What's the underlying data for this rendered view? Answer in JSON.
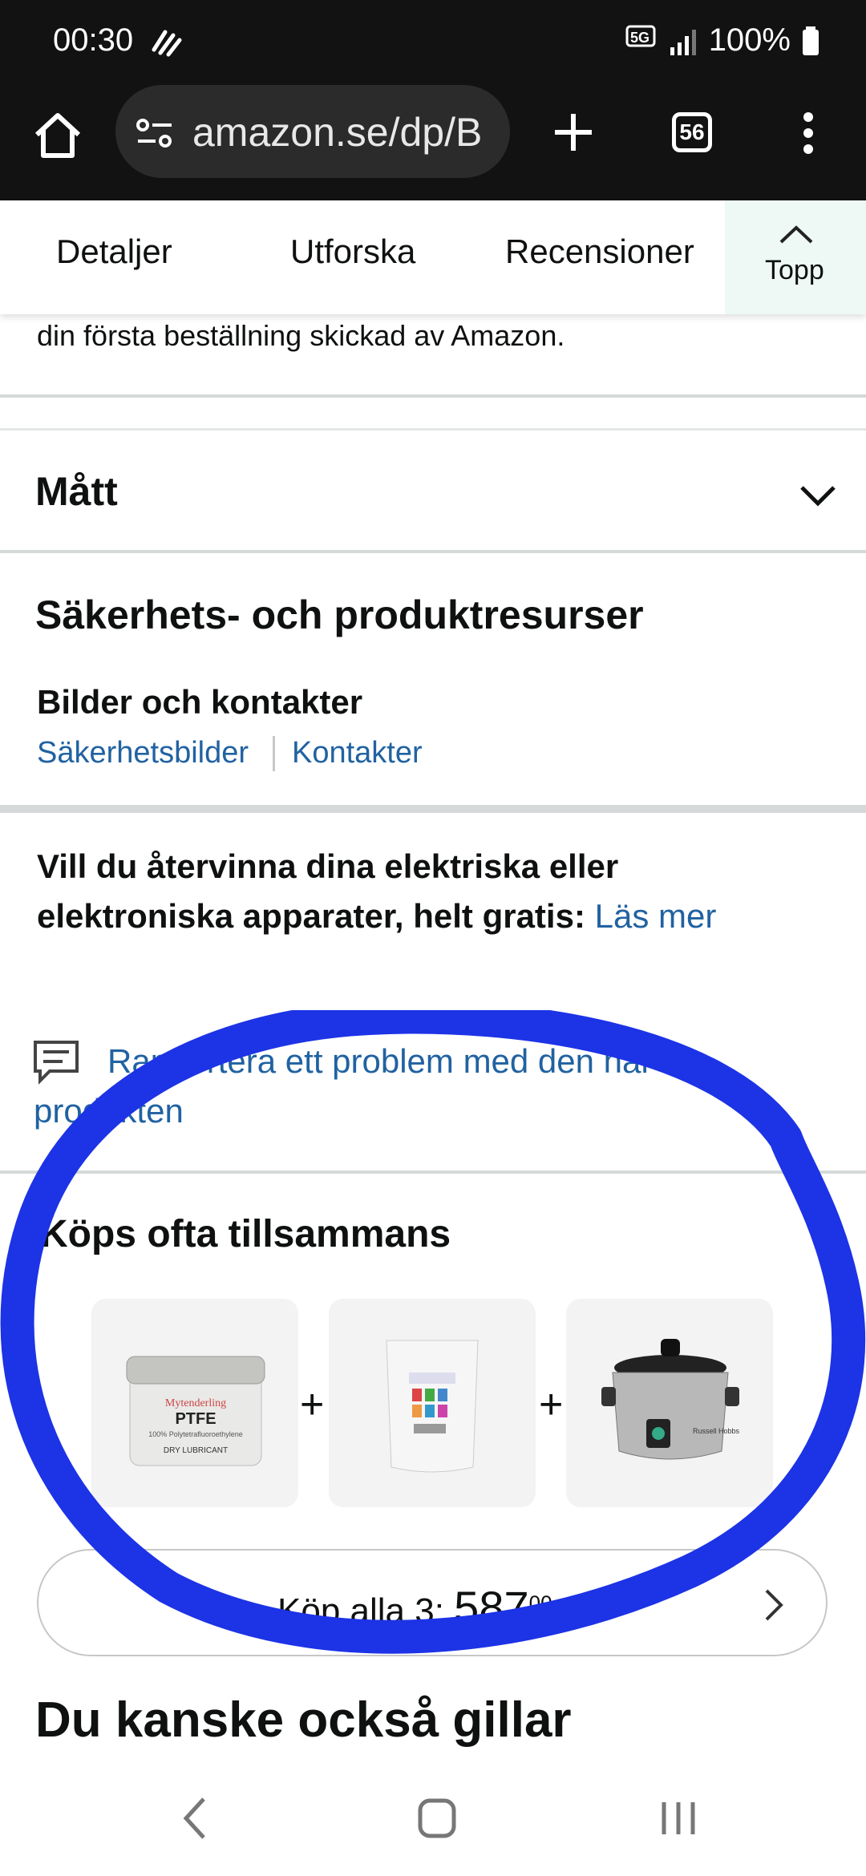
{
  "status": {
    "time": "00:30",
    "network": "5G",
    "battery": "100%"
  },
  "browser": {
    "url": "amazon.se/dp/B",
    "tab_count": "56"
  },
  "nav_tabs": {
    "details": "Detaljer",
    "explore": "Utforska",
    "reviews": "Recensioner",
    "top": "Topp"
  },
  "content": {
    "top_text": "din första beställning skickad av Amazon.",
    "dimensions": "Mått",
    "safety_title": "Säkerhets- och produktresurser",
    "images_contacts": "Bilder och kontakter",
    "safety_images_link": "Säkerhetsbilder",
    "contacts_link": "Kontakter",
    "recycle_text": "Vill du återvinna dina elektriska eller elektroniska apparater, helt gratis:",
    "read_more": "Läs mer",
    "report_line1": "Rapportera ett problem med den här",
    "report_line2": "produkten",
    "fbt_title": "Köps ofta tillsammans",
    "products": [
      {
        "name": "PTFE",
        "brand": "Mytenderling",
        "subtitle": "100% Polytetrafluoroethylene",
        "label": "DRY LUBRICANT"
      },
      {
        "name": "powder pouch"
      },
      {
        "name": "Russell Hobbs slow cooker",
        "brand": "Russell Hobbs"
      }
    ],
    "buy_all_label": "Köp alla 3:",
    "buy_all_price": "587",
    "buy_all_cents": "00",
    "also_like": "Du kanske också gillar"
  },
  "colors": {
    "link": "#2162a1",
    "annotation": "#1c33e6",
    "statusbar": "#121212"
  }
}
